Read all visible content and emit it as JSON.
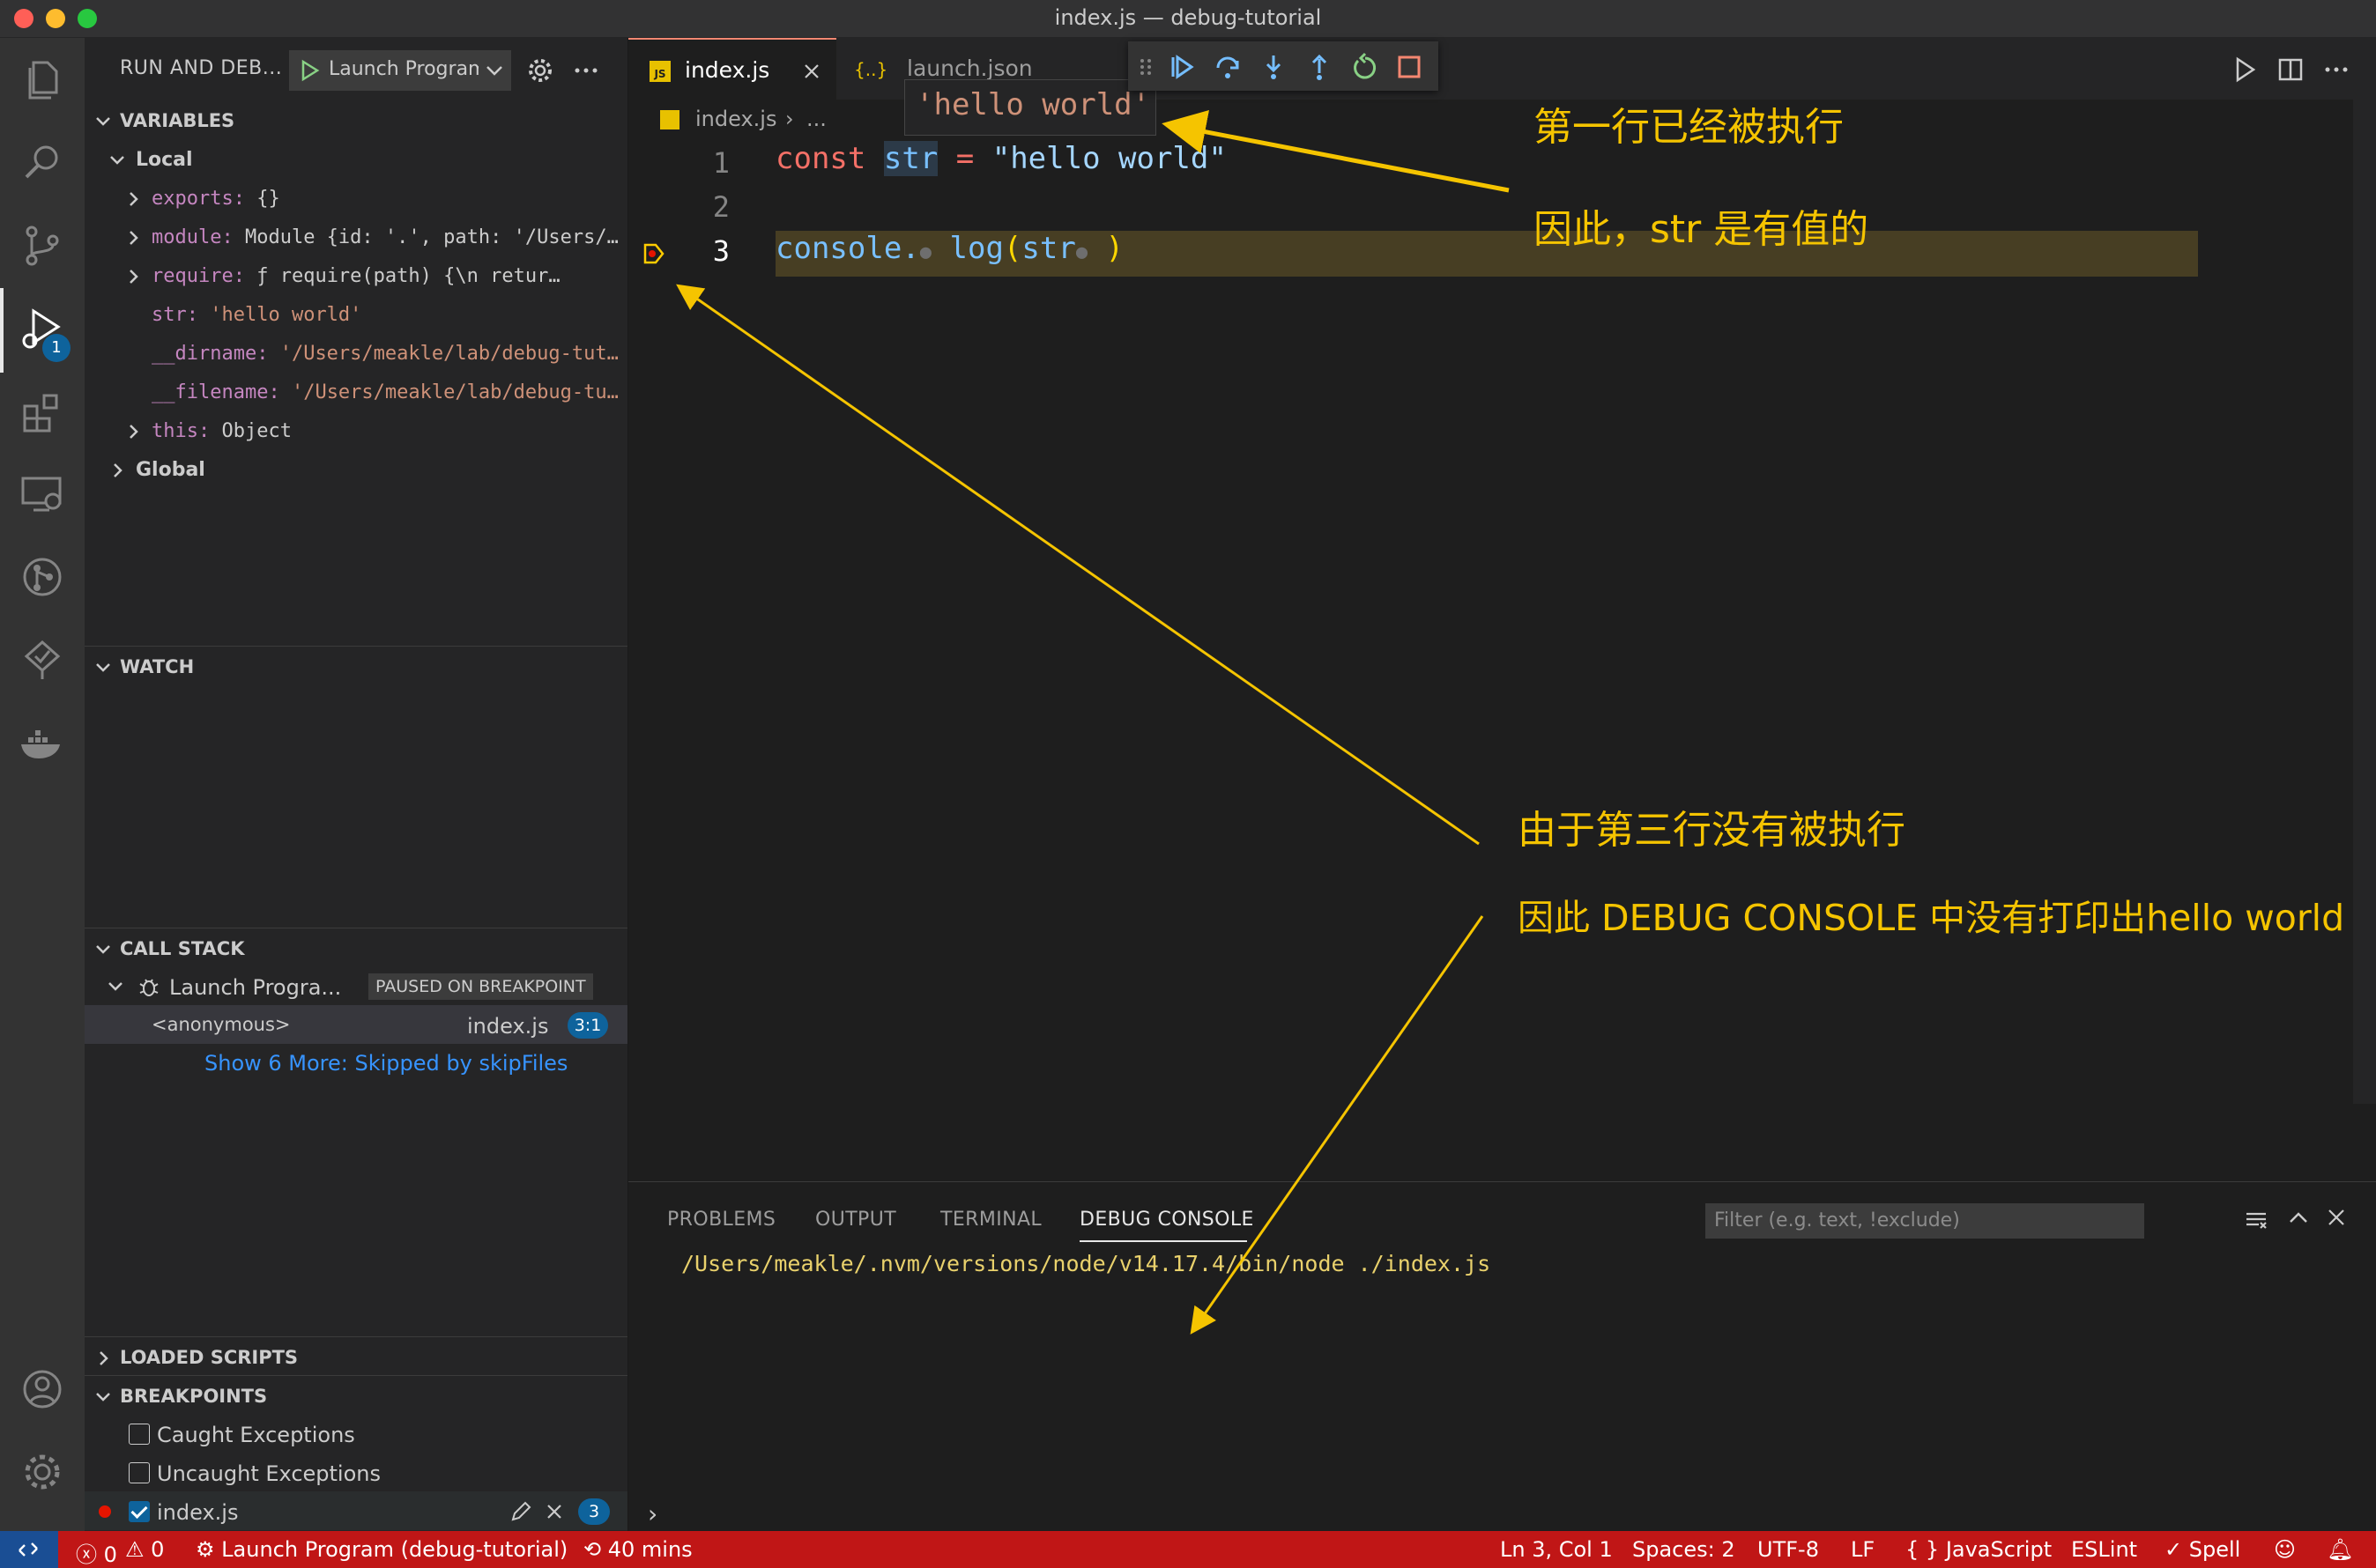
{
  "window": {
    "title": "index.js — debug-tutorial"
  },
  "sidebar": {
    "title": "RUN AND DEB...",
    "launch_config": "Launch Program",
    "variables": {
      "header": "VARIABLES",
      "local_label": "Local",
      "items": [
        {
          "name": "exports:",
          "value": "{}"
        },
        {
          "name": "module:",
          "value": "Module {id: '.', path: '/Users/…"
        },
        {
          "name": "require:",
          "value": "ƒ require(path) {\\n       retur…"
        },
        {
          "name": "str:",
          "value": "'hello world'"
        },
        {
          "name": "__dirname:",
          "value": "'/Users/meakle/lab/debug-tut…"
        },
        {
          "name": "__filename:",
          "value": "'/Users/meakle/lab/debug-tu…"
        },
        {
          "name": "this:",
          "value": "Object"
        }
      ],
      "global_label": "Global"
    },
    "watch": {
      "header": "WATCH"
    },
    "call_stack": {
      "header": "CALL STACK",
      "session": "Launch Progra...",
      "state": "PAUSED ON BREAKPOINT",
      "frame_name": "<anonymous>",
      "frame_file": "index.js",
      "frame_pos": "3:1",
      "show_more": "Show 6 More: Skipped by skipFiles"
    },
    "loaded_scripts": {
      "header": "LOADED SCRIPTS"
    },
    "breakpoints": {
      "header": "BREAKPOINTS",
      "items": [
        {
          "label": "Caught Exceptions",
          "checked": false
        },
        {
          "label": "Uncaught Exceptions",
          "checked": false
        },
        {
          "label": "index.js",
          "checked": true,
          "count": "3"
        }
      ]
    }
  },
  "activity_bar": {
    "debug_badge": "1",
    "icons": [
      "files-icon",
      "search-icon",
      "source-control-icon",
      "run-debug-icon",
      "extensions-icon",
      "remote-explorer-icon",
      "git-graph-icon",
      "testing-icon",
      "docker-icon",
      "account-icon",
      "settings-gear-icon"
    ]
  },
  "editor": {
    "tabs": [
      {
        "label": "index.js",
        "icon": "JS",
        "active": true
      },
      {
        "label": "launch.json",
        "icon": "{..}",
        "active": false
      }
    ],
    "breadcrumb": {
      "file": "index.js",
      "rest": "..."
    },
    "hover": "'hello world'",
    "lines": [
      {
        "num": "1",
        "kw": "const",
        "id": "str",
        "op": "=",
        "str": "\"hello world\""
      },
      {
        "num": "2"
      },
      {
        "num": "3",
        "obj": "console.",
        "fn": "log",
        "open": "(",
        "arg": "str",
        "close": " )"
      }
    ]
  },
  "panel": {
    "tabs": [
      "PROBLEMS",
      "OUTPUT",
      "TERMINAL",
      "DEBUG CONSOLE"
    ],
    "active_tab": "DEBUG CONSOLE",
    "filter_placeholder": "Filter (e.g. text, !exclude)",
    "console_output": "/Users/meakle/.nvm/versions/node/v14.17.4/bin/node ./index.js"
  },
  "status_bar": {
    "errors": "0",
    "warnings": "0",
    "launch": "Launch Program (debug-tutorial)",
    "time": "40 mins",
    "position": "Ln 3, Col 1",
    "spaces": "Spaces: 2",
    "encoding": "UTF-8",
    "eol": "LF",
    "language": "JavaScript",
    "eslint": "ESLint",
    "spell": "Spell",
    "colors": {
      "background": "#c01616",
      "remote": "#1a4e94"
    }
  },
  "annotations": {
    "line1_executed": "第一行已经被执行",
    "str_has_value": "因此，str 是有值的",
    "line3_not_executed": "由于第三行没有被执行",
    "console_empty": "因此 DEBUG CONSOLE 中没有打印出hello world",
    "color": "#f5c400"
  }
}
